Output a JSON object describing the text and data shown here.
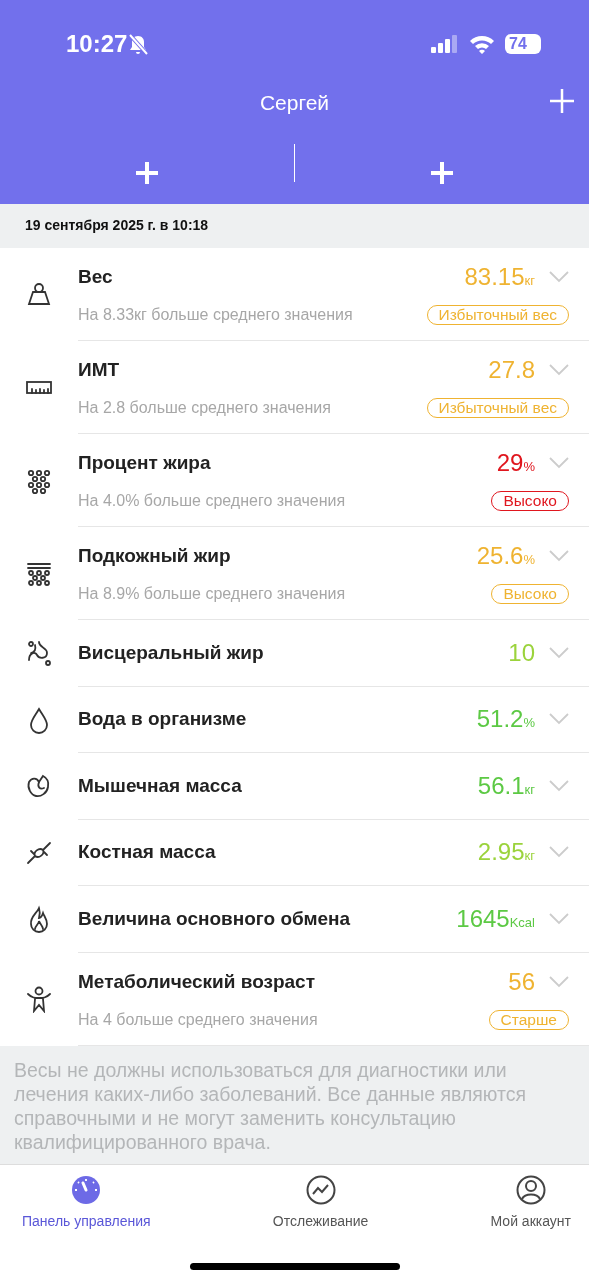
{
  "status_bar": {
    "time": "10:27",
    "battery": "74"
  },
  "header": {
    "title": "Сергей"
  },
  "date": "19 сентября 2025 г. в 10:18",
  "metrics": [
    {
      "name": "Вес",
      "value": "83.15",
      "unit": "кг",
      "color": "#efb331",
      "note": "На 8.33кг больше среднего значения",
      "badge": "Избыточный вес"
    },
    {
      "name": "ИМТ",
      "value": "27.8",
      "color": "#efb331",
      "note": "На 2.8 больше среднего значения",
      "badge": "Избыточный вес"
    },
    {
      "name": "Процент жира",
      "value": "29",
      "unit": "%",
      "color": "#e0161e",
      "note": "На 4.0% больше среднего значения",
      "badge": "Высоко"
    },
    {
      "name": "Подкожный жир",
      "value": "25.6",
      "unit": "%",
      "color": "#efb331",
      "note": "На 8.9% больше среднего значения",
      "badge": "Высоко"
    },
    {
      "name": "Висцеральный жир",
      "value": "10",
      "color": "#9bd33c"
    },
    {
      "name": "Вода в организме",
      "value": "51.2",
      "unit": "%",
      "color": "#5cc944"
    },
    {
      "name": "Мышечная масса",
      "value": "56.1",
      "unit": "кг",
      "color": "#5cc944"
    },
    {
      "name": "Костная масса",
      "value": "2.95",
      "unit": "кг",
      "color": "#9bd33c"
    },
    {
      "name": "Величина основного обмена",
      "value": "1645",
      "unit": "Kcal",
      "color": "#5cc944"
    },
    {
      "name": "Метаболический возраст",
      "value": "56",
      "color": "#efb331",
      "note": "На 4 больше среднего значения",
      "badge": "Старше"
    }
  ],
  "disclaimer": "Весы не должны использоваться для диагностики или лечения каких-либо заболеваний. Все данные являются справочными и не могут заменить консультацию квалифицированного врача.",
  "tabs": [
    {
      "label": "Панель управления",
      "selected": true
    },
    {
      "label": "Отслеживание",
      "selected": false
    },
    {
      "label": "Мой аккаунт",
      "selected": false
    }
  ]
}
